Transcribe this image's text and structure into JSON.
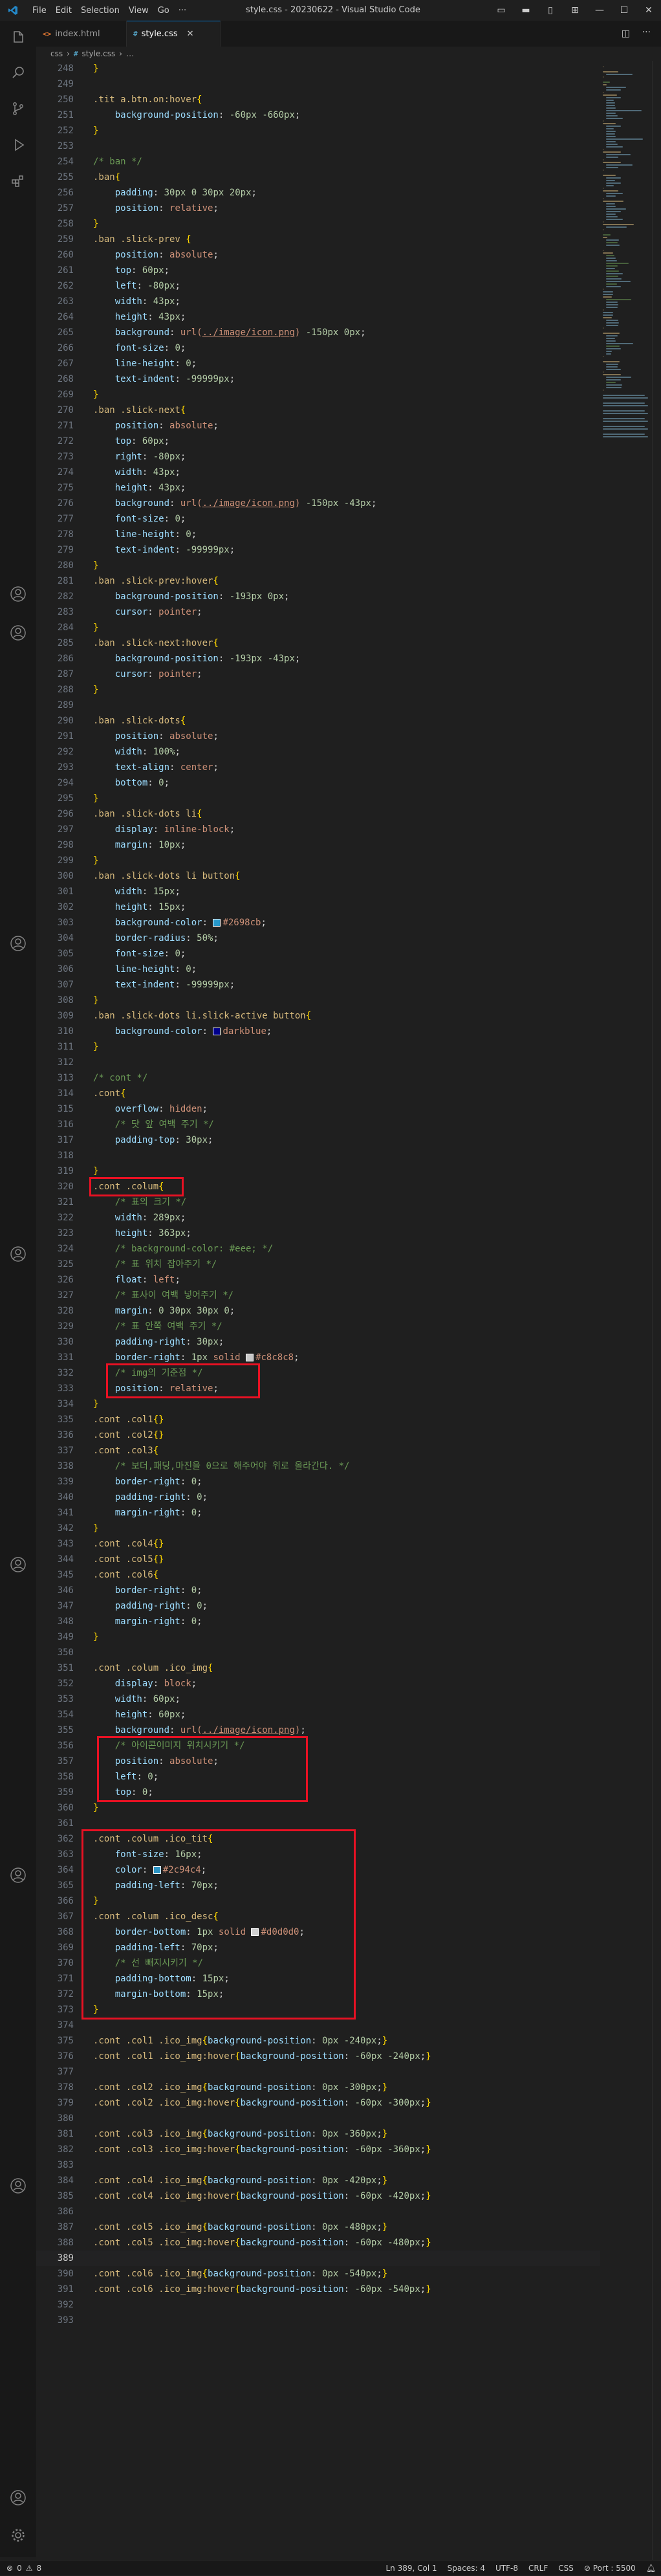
{
  "window": {
    "title": "style.css - 20230622 - Visual Studio Code",
    "menu": [
      "File",
      "Edit",
      "Selection",
      "View",
      "Go",
      "···"
    ]
  },
  "tabs": [
    {
      "label": "index.html",
      "icon": "html-file-icon",
      "active": false
    },
    {
      "label": "style.css",
      "icon": "css-file-icon",
      "active": true
    }
  ],
  "breadcrumbs": [
    "css",
    "style.css"
  ],
  "editor": {
    "current_line": 389,
    "lines": [
      {
        "n": 248,
        "t": "}"
      },
      {
        "n": 249,
        "t": ""
      },
      {
        "n": 250,
        "t": ".tit a.btn.on:hover{"
      },
      {
        "n": 251,
        "t": "    background-position: -60px -660px;"
      },
      {
        "n": 252,
        "t": "}"
      },
      {
        "n": 253,
        "t": ""
      },
      {
        "n": 254,
        "t": "/* ban */"
      },
      {
        "n": 255,
        "t": ".ban{"
      },
      {
        "n": 256,
        "t": "    padding: 30px 0 30px 20px;"
      },
      {
        "n": 257,
        "t": "    position: relative;"
      },
      {
        "n": 258,
        "t": "}"
      },
      {
        "n": 259,
        "t": ".ban .slick-prev {"
      },
      {
        "n": 260,
        "t": "    position: absolute;"
      },
      {
        "n": 261,
        "t": "    top: 60px;"
      },
      {
        "n": 262,
        "t": "    left: -80px;"
      },
      {
        "n": 263,
        "t": "    width: 43px;"
      },
      {
        "n": 264,
        "t": "    height: 43px;"
      },
      {
        "n": 265,
        "t": "    background: url(../image/icon.png) -150px 0px;"
      },
      {
        "n": 266,
        "t": "    font-size: 0;"
      },
      {
        "n": 267,
        "t": "    line-height: 0;"
      },
      {
        "n": 268,
        "t": "    text-indent: -99999px;"
      },
      {
        "n": 269,
        "t": "}"
      },
      {
        "n": 270,
        "t": ".ban .slick-next{"
      },
      {
        "n": 271,
        "t": "    position: absolute;"
      },
      {
        "n": 272,
        "t": "    top: 60px;"
      },
      {
        "n": 273,
        "t": "    right: -80px;"
      },
      {
        "n": 274,
        "t": "    width: 43px;"
      },
      {
        "n": 275,
        "t": "    height: 43px;"
      },
      {
        "n": 276,
        "t": "    background: url(../image/icon.png) -150px -43px;"
      },
      {
        "n": 277,
        "t": "    font-size: 0;"
      },
      {
        "n": 278,
        "t": "    line-height: 0;"
      },
      {
        "n": 279,
        "t": "    text-indent: -99999px;"
      },
      {
        "n": 280,
        "t": "}"
      },
      {
        "n": 281,
        "t": ".ban .slick-prev:hover{"
      },
      {
        "n": 282,
        "t": "    background-position: -193px 0px;"
      },
      {
        "n": 283,
        "t": "    cursor: pointer;"
      },
      {
        "n": 284,
        "t": "}"
      },
      {
        "n": 285,
        "t": ".ban .slick-next:hover{"
      },
      {
        "n": 286,
        "t": "    background-position: -193px -43px;"
      },
      {
        "n": 287,
        "t": "    cursor: pointer;"
      },
      {
        "n": 288,
        "t": "}"
      },
      {
        "n": 289,
        "t": ""
      },
      {
        "n": 290,
        "t": ".ban .slick-dots{"
      },
      {
        "n": 291,
        "t": "    position: absolute;"
      },
      {
        "n": 292,
        "t": "    width: 100%;"
      },
      {
        "n": 293,
        "t": "    text-align: center;"
      },
      {
        "n": 294,
        "t": "    bottom: 0;"
      },
      {
        "n": 295,
        "t": "}"
      },
      {
        "n": 296,
        "t": ".ban .slick-dots li{"
      },
      {
        "n": 297,
        "t": "    display: inline-block;"
      },
      {
        "n": 298,
        "t": "    margin: 10px;"
      },
      {
        "n": 299,
        "t": "}"
      },
      {
        "n": 300,
        "t": ".ban .slick-dots li button{"
      },
      {
        "n": 301,
        "t": "    width: 15px;"
      },
      {
        "n": 302,
        "t": "    height: 15px;"
      },
      {
        "n": 303,
        "t": "    background-color: #2698cb;"
      },
      {
        "n": 304,
        "t": "    border-radius: 50%;"
      },
      {
        "n": 305,
        "t": "    font-size: 0;"
      },
      {
        "n": 306,
        "t": "    line-height: 0;"
      },
      {
        "n": 307,
        "t": "    text-indent: -99999px;"
      },
      {
        "n": 308,
        "t": "}"
      },
      {
        "n": 309,
        "t": ".ban .slick-dots li.slick-active button{"
      },
      {
        "n": 310,
        "t": "    background-color: darkblue;"
      },
      {
        "n": 311,
        "t": "}"
      },
      {
        "n": 312,
        "t": ""
      },
      {
        "n": 313,
        "t": "/* cont */"
      },
      {
        "n": 314,
        "t": ".cont{"
      },
      {
        "n": 315,
        "t": "    overflow: hidden;"
      },
      {
        "n": 316,
        "t": "    /* 닷 앞 여백 주기 */"
      },
      {
        "n": 317,
        "t": "    padding-top: 30px;"
      },
      {
        "n": 318,
        "t": ""
      },
      {
        "n": 319,
        "t": "}"
      },
      {
        "n": 320,
        "t": ".cont .colum{"
      },
      {
        "n": 321,
        "t": "    /* 표의 크기 */"
      },
      {
        "n": 322,
        "t": "    width: 289px;"
      },
      {
        "n": 323,
        "t": "    height: 363px;"
      },
      {
        "n": 324,
        "t": "    /* background-color: #eee; */"
      },
      {
        "n": 325,
        "t": "    /* 표 위치 잡아주기 */"
      },
      {
        "n": 326,
        "t": "    float: left;"
      },
      {
        "n": 327,
        "t": "    /* 표사이 여백 넣어주기 */"
      },
      {
        "n": 328,
        "t": "    margin: 0 30px 30px 0;"
      },
      {
        "n": 329,
        "t": "    /* 표 안쪽 여백 주기 */"
      },
      {
        "n": 330,
        "t": "    padding-right: 30px;"
      },
      {
        "n": 331,
        "t": "    border-right: 1px solid #c8c8c8;"
      },
      {
        "n": 332,
        "t": "    /* img의 기준점 */"
      },
      {
        "n": 333,
        "t": "    position: relative;"
      },
      {
        "n": 334,
        "t": "}"
      },
      {
        "n": 335,
        "t": ".cont .col1{}"
      },
      {
        "n": 336,
        "t": ".cont .col2{}"
      },
      {
        "n": 337,
        "t": ".cont .col3{"
      },
      {
        "n": 338,
        "t": "    /* 보더,패딩,마진을 0으로 해주어야 위로 올라간다. */"
      },
      {
        "n": 339,
        "t": "    border-right:0;"
      },
      {
        "n": 340,
        "t": "    padding-right:0;"
      },
      {
        "n": 341,
        "t": "    margin-right:0;"
      },
      {
        "n": 342,
        "t": "}"
      },
      {
        "n": 343,
        "t": ".cont .col4{}"
      },
      {
        "n": 344,
        "t": ".cont .col5{}"
      },
      {
        "n": 345,
        "t": ".cont .col6{"
      },
      {
        "n": 346,
        "t": "    border-right: 0;"
      },
      {
        "n": 347,
        "t": "    padding-right: 0;"
      },
      {
        "n": 348,
        "t": "    margin-right: 0;"
      },
      {
        "n": 349,
        "t": "}"
      },
      {
        "n": 350,
        "t": ""
      },
      {
        "n": 351,
        "t": ".cont .colum .ico_img{"
      },
      {
        "n": 352,
        "t": "    display: block;"
      },
      {
        "n": 353,
        "t": "    width: 60px;"
      },
      {
        "n": 354,
        "t": "    height: 60px;"
      },
      {
        "n": 355,
        "t": "    background: url(../image/icon.png);"
      },
      {
        "n": 356,
        "t": "    /* 아이콘이미지 위치시키기 */"
      },
      {
        "n": 357,
        "t": "    position: absolute;"
      },
      {
        "n": 358,
        "t": "    left: 0;"
      },
      {
        "n": 359,
        "t": "    top: 0;"
      },
      {
        "n": 360,
        "t": "}"
      },
      {
        "n": 361,
        "t": ""
      },
      {
        "n": 362,
        "t": ".cont .colum .ico_tit{"
      },
      {
        "n": 363,
        "t": "    font-size: 16px;"
      },
      {
        "n": 364,
        "t": "    color: #2c94c4;"
      },
      {
        "n": 365,
        "t": "    padding-left: 70px;"
      },
      {
        "n": 366,
        "t": "}"
      },
      {
        "n": 367,
        "t": ".cont .colum .ico_desc{"
      },
      {
        "n": 368,
        "t": "    border-bottom: 1px solid #d0d0d0;"
      },
      {
        "n": 369,
        "t": "    padding-left: 70px;"
      },
      {
        "n": 370,
        "t": "    /* 선 빼지시키기 */"
      },
      {
        "n": 371,
        "t": "    padding-bottom: 15px;"
      },
      {
        "n": 372,
        "t": "    margin-bottom: 15px;"
      },
      {
        "n": 373,
        "t": "}"
      },
      {
        "n": 374,
        "t": ""
      },
      {
        "n": 375,
        "t": ".cont .col1 .ico_img{background-position: 0px -240px;}"
      },
      {
        "n": 376,
        "t": ".cont .col1 .ico_img:hover{background-position: -60px -240px;}"
      },
      {
        "n": 377,
        "t": ""
      },
      {
        "n": 378,
        "t": ".cont .col2 .ico_img{background-position: 0px -300px;}"
      },
      {
        "n": 379,
        "t": ".cont .col2 .ico_img:hover{background-position: -60px -300px;}"
      },
      {
        "n": 380,
        "t": ""
      },
      {
        "n": 381,
        "t": ".cont .col3 .ico_img{background-position: 0px -360px;}"
      },
      {
        "n": 382,
        "t": ".cont .col3 .ico_img:hover{background-position: -60px -360px;}"
      },
      {
        "n": 383,
        "t": ""
      },
      {
        "n": 384,
        "t": ".cont .col4 .ico_img{background-position: 0px -420px;}"
      },
      {
        "n": 385,
        "t": ".cont .col4 .ico_img:hover{background-position: -60px -420px;}"
      },
      {
        "n": 386,
        "t": ""
      },
      {
        "n": 387,
        "t": ".cont .col5 .ico_img{background-position: 0px -480px;}"
      },
      {
        "n": 388,
        "t": ".cont .col5 .ico_img:hover{background-position: -60px -480px;}"
      },
      {
        "n": 389,
        "t": ""
      },
      {
        "n": 390,
        "t": ".cont .col6 .ico_img{background-position: 0px -540px;}"
      },
      {
        "n": 391,
        "t": ".cont .col6 .ico_img:hover{background-position: -60px -540px;}"
      },
      {
        "n": 392,
        "t": ""
      },
      {
        "n": 393,
        "t": ""
      }
    ]
  },
  "status": {
    "errors": "0",
    "warnings": "8",
    "position": "Ln 389, Col 1",
    "spaces": "Spaces: 4",
    "encoding": "UTF-8",
    "eol": "CRLF",
    "language": "CSS",
    "port": "Port : 5500"
  },
  "colors": {
    "accent": "#0078d4",
    "highlight_box": "#e81123",
    "swatch_2698cb": "#2698cb",
    "swatch_darkblue": "#00008b",
    "swatch_c8c8c8": "#c8c8c8",
    "swatch_2c94c4": "#2c94c4",
    "swatch_d0d0d0": "#d0d0d0"
  }
}
